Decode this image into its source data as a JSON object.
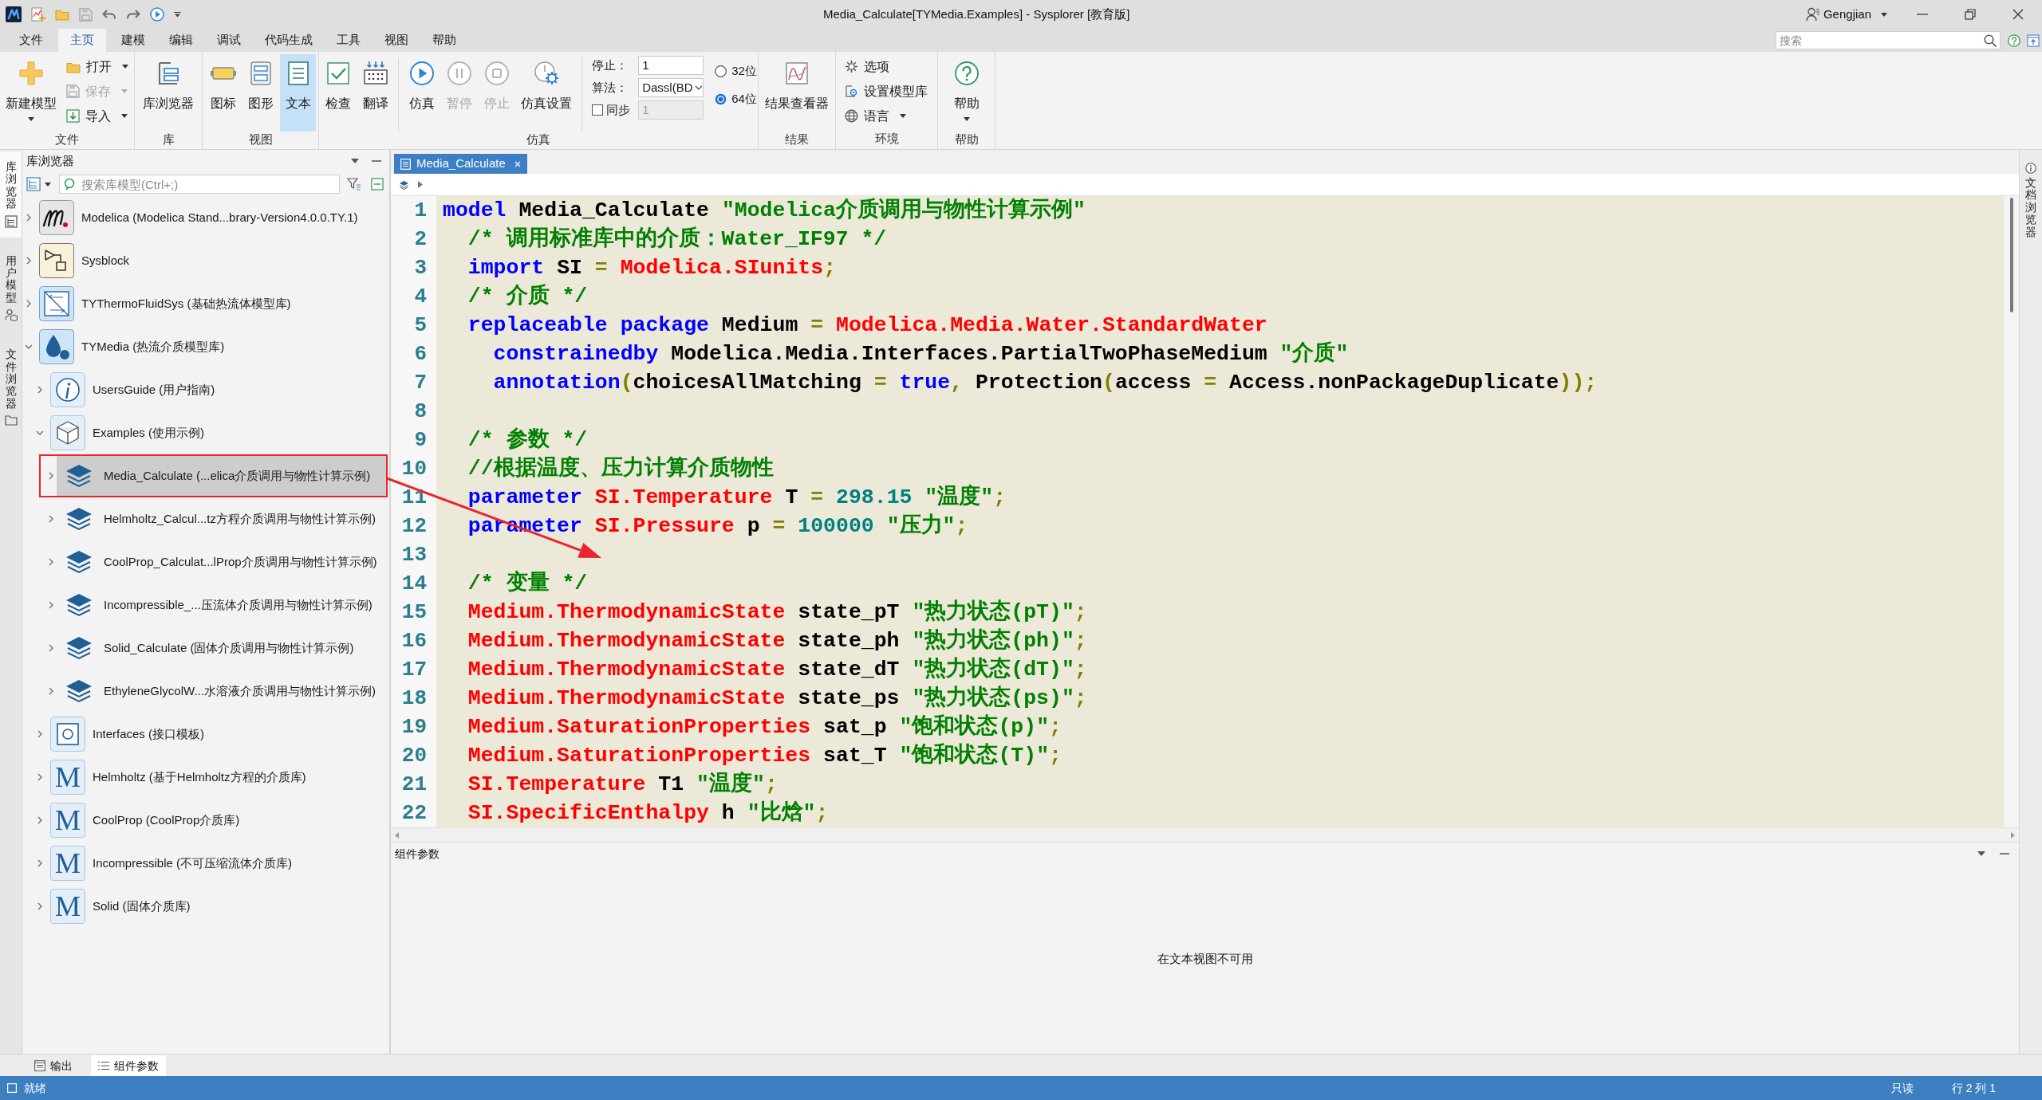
{
  "window": {
    "title": "Media_Calculate[TYMedia.Examples] - Sysplorer [教育版]",
    "user": "Gengjian"
  },
  "menu_bar": {
    "tabs": [
      {
        "label": "文件",
        "selected": false
      },
      {
        "label": "主页",
        "selected": true
      },
      {
        "label": "建模",
        "selected": false
      },
      {
        "label": "编辑",
        "selected": false
      },
      {
        "label": "调试",
        "selected": false
      },
      {
        "label": "代码生成",
        "selected": false
      },
      {
        "label": "工具",
        "selected": false
      },
      {
        "label": "视图",
        "selected": false
      },
      {
        "label": "帮助",
        "selected": false
      }
    ],
    "search": {
      "placeholder": "搜索"
    }
  },
  "ribbon": [
    {
      "label": "文件",
      "items": [
        {
          "kind": "large",
          "label": "新建模型",
          "dropdown": true,
          "disabled": false
        },
        {
          "kind": "stack",
          "buttons": [
            {
              "label": "打开",
              "dropdown": true,
              "disabled": false
            },
            {
              "label": "保存",
              "dropdown": true,
              "disabled": true
            },
            {
              "label": "导入",
              "dropdown": true,
              "disabled": false
            }
          ]
        }
      ]
    },
    {
      "label": "库",
      "items": [
        {
          "kind": "large",
          "label": "库浏览器",
          "dropdown": false,
          "disabled": false
        }
      ]
    },
    {
      "label": "视图",
      "items": [
        {
          "kind": "large",
          "label": "图标",
          "dropdown": false,
          "disabled": false,
          "selected": false
        },
        {
          "kind": "large",
          "label": "图形",
          "dropdown": false,
          "disabled": false,
          "selected": false
        },
        {
          "kind": "large",
          "label": "文本",
          "dropdown": false,
          "disabled": false,
          "selected": true
        }
      ]
    },
    {
      "label": "仿真",
      "items": [
        {
          "kind": "large",
          "label": "检查",
          "dropdown": false,
          "disabled": false
        },
        {
          "kind": "large",
          "label": "翻译",
          "dropdown": false,
          "disabled": false
        },
        {
          "kind": "separator"
        },
        {
          "kind": "large",
          "label": "仿真",
          "dropdown": false,
          "disabled": false
        },
        {
          "kind": "large",
          "label": "暂停",
          "dropdown": false,
          "disabled": true
        },
        {
          "kind": "large",
          "label": "停止",
          "dropdown": false,
          "disabled": true
        },
        {
          "kind": "large",
          "label": "仿真设置",
          "dropdown": false,
          "disabled": false
        },
        {
          "kind": "separator"
        },
        {
          "kind": "form",
          "fields": [
            {
              "kind": "input",
              "label": "停止：",
              "value": "1",
              "disabled": false
            },
            {
              "kind": "select",
              "label": "算法：",
              "value": "Dassl(BD"
            },
            {
              "kind": "checkbox",
              "label": "同步",
              "checked": false,
              "value": "1",
              "disabled": true
            }
          ]
        },
        {
          "kind": "radios",
          "options": [
            {
              "label": "32位",
              "selected": false
            },
            {
              "label": "64位",
              "selected": true
            }
          ]
        }
      ]
    },
    {
      "label": "结果",
      "items": [
        {
          "kind": "large",
          "label": "结果查看器",
          "dropdown": false,
          "disabled": false
        }
      ]
    },
    {
      "label": "环境",
      "items": [
        {
          "kind": "stack",
          "buttons": [
            {
              "label": "选项",
              "dropdown": false,
              "disabled": false
            },
            {
              "label": "设置模型库",
              "dropdown": false,
              "disabled": false
            },
            {
              "label": "语言",
              "dropdown": true,
              "disabled": false
            }
          ]
        }
      ]
    },
    {
      "label": "帮助",
      "items": [
        {
          "kind": "large",
          "label": "帮助",
          "dropdown": true,
          "disabled": false
        }
      ]
    }
  ],
  "side_tabs": [
    {
      "label": "库浏览器",
      "selected": true
    },
    {
      "label": "用户模型",
      "selected": false
    },
    {
      "label": "文件浏览器",
      "selected": false
    }
  ],
  "library_browser": {
    "title": "库浏览器",
    "search": {
      "placeholder": "搜索库模型(Ctrl+;)"
    },
    "tree": [
      {
        "label": "Modelica (Modelica Stand...brary-Version4.0.0.TY.1)",
        "kind": "modelica",
        "expanded": false,
        "selected": false,
        "annotated": false
      },
      {
        "label": "Sysblock",
        "kind": "sysblock",
        "expanded": false,
        "selected": false,
        "annotated": false
      },
      {
        "label": "TYThermoFluidSys (基础热流体模型库)",
        "kind": "fluidsys",
        "expanded": false,
        "selected": false,
        "annotated": false
      },
      {
        "label": "TYMedia (热流介质模型库)",
        "kind": "media",
        "expanded": true,
        "selected": false,
        "annotated": false,
        "children": [
          {
            "label": "UsersGuide (用户指南)",
            "kind": "guide",
            "expanded": false,
            "selected": false,
            "annotated": false
          },
          {
            "label": "Examples (使用示例)",
            "kind": "examples",
            "expanded": true,
            "selected": false,
            "annotated": false,
            "children": [
              {
                "label": "Media_Calculate (...elica介质调用与物性计算示例)",
                "kind": "example",
                "expanded": false,
                "selected": true,
                "annotated": true
              },
              {
                "label": "Helmholtz_Calcul...tz方程介质调用与物性计算示例)",
                "kind": "example",
                "expanded": false,
                "selected": false,
                "annotated": false
              },
              {
                "label": "CoolProp_Calculat...lProp介质调用与物性计算示例)",
                "kind": "example",
                "expanded": false,
                "selected": false,
                "annotated": false
              },
              {
                "label": "Incompressible_...压流体介质调用与物性计算示例)",
                "kind": "example",
                "expanded": false,
                "selected": false,
                "annotated": false
              },
              {
                "label": "Solid_Calculate (固体介质调用与物性计算示例)",
                "kind": "example",
                "expanded": false,
                "selected": false,
                "annotated": false
              },
              {
                "label": "EthyleneGlycolW...水溶液介质调用与物性计算示例)",
                "kind": "example",
                "expanded": false,
                "selected": false,
                "annotated": false
              }
            ]
          },
          {
            "label": "Interfaces (接口模板)",
            "kind": "interfaces",
            "expanded": false,
            "selected": false,
            "annotated": false
          },
          {
            "label": "Helmholtz (基于Helmholtz方程的介质库)",
            "kind": "package",
            "badge": "M",
            "expanded": false,
            "selected": false,
            "annotated": false
          },
          {
            "label": "CoolProp (CoolProp介质库)",
            "kind": "package",
            "badge": "M",
            "expanded": false,
            "selected": false,
            "annotated": false
          },
          {
            "label": "Incompressible (不可压缩流体介质库)",
            "kind": "package",
            "badge": "M",
            "expanded": false,
            "selected": false,
            "annotated": false
          },
          {
            "label": "Solid (固体介质库)",
            "kind": "package",
            "badge": "M",
            "expanded": false,
            "selected": false,
            "annotated": false
          }
        ]
      }
    ]
  },
  "editor": {
    "tabs": [
      {
        "label": "Media_Calculate",
        "selected": true
      }
    ],
    "lines": [
      {
        "number": "1",
        "tokens": [
          {
            "kind": "keyword",
            "text": "model"
          },
          {
            "kind": "plain",
            "text": " Media_Calculate "
          },
          {
            "kind": "string",
            "text": "\"Modelica介质调用与物性计算示例\""
          }
        ]
      },
      {
        "number": "2",
        "tokens": [
          {
            "kind": "comment",
            "text": "  /* 调用标准库中的介质：Water_IF97 */"
          }
        ]
      },
      {
        "number": "3",
        "tokens": [
          {
            "kind": "keyword",
            "text": "  import"
          },
          {
            "kind": "plain",
            "text": " SI "
          },
          {
            "kind": "operator",
            "text": "= "
          },
          {
            "kind": "type",
            "text": "Modelica.SIunits"
          },
          {
            "kind": "operator",
            "text": ";"
          }
        ]
      },
      {
        "number": "4",
        "tokens": [
          {
            "kind": "comment",
            "text": "  /* 介质 */"
          }
        ]
      },
      {
        "number": "5",
        "tokens": [
          {
            "kind": "keyword",
            "text": "  replaceable package"
          },
          {
            "kind": "plain",
            "text": " Medium "
          },
          {
            "kind": "operator",
            "text": "= "
          },
          {
            "kind": "type",
            "text": "Modelica.Media.Water.StandardWater"
          }
        ]
      },
      {
        "number": "6",
        "tokens": [
          {
            "kind": "keyword",
            "text": "    constrainedby"
          },
          {
            "kind": "plain",
            "text": " Modelica.Media.Interfaces.PartialTwoPhaseMedium "
          },
          {
            "kind": "string",
            "text": "\"介质\""
          }
        ]
      },
      {
        "number": "7",
        "tokens": [
          {
            "kind": "keyword",
            "text": "    annotation"
          },
          {
            "kind": "operator",
            "text": "("
          },
          {
            "kind": "plain",
            "text": "choicesAllMatching "
          },
          {
            "kind": "operator",
            "text": "= "
          },
          {
            "kind": "keyword",
            "text": "true"
          },
          {
            "kind": "operator",
            "text": ", "
          },
          {
            "kind": "plain",
            "text": "Protection"
          },
          {
            "kind": "operator",
            "text": "("
          },
          {
            "kind": "plain",
            "text": "access "
          },
          {
            "kind": "operator",
            "text": "= "
          },
          {
            "kind": "plain",
            "text": "Access.nonPackageDuplicate"
          },
          {
            "kind": "operator",
            "text": "));"
          }
        ]
      },
      {
        "number": "8"
      },
      {
        "number": "9",
        "tokens": [
          {
            "kind": "comment",
            "text": "  /* 参数 */"
          }
        ]
      },
      {
        "number": "10",
        "tokens": [
          {
            "kind": "comment",
            "text": "  //根据温度、压力计算介质物性"
          }
        ]
      },
      {
        "number": "11",
        "tokens": [
          {
            "kind": "keyword",
            "text": "  parameter "
          },
          {
            "kind": "type",
            "text": "SI.Temperature"
          },
          {
            "kind": "plain",
            "text": " T "
          },
          {
            "kind": "operator",
            "text": "= "
          },
          {
            "kind": "number",
            "text": "298.15 "
          },
          {
            "kind": "string",
            "text": "\"温度\""
          },
          {
            "kind": "operator",
            "text": ";"
          }
        ]
      },
      {
        "number": "12",
        "tokens": [
          {
            "kind": "keyword",
            "text": "  parameter "
          },
          {
            "kind": "type",
            "text": "SI.Pressure"
          },
          {
            "kind": "plain",
            "text": " p "
          },
          {
            "kind": "operator",
            "text": "= "
          },
          {
            "kind": "number",
            "text": "100000 "
          },
          {
            "kind": "string",
            "text": "\"压力\""
          },
          {
            "kind": "operator",
            "text": ";"
          }
        ]
      },
      {
        "number": "13"
      },
      {
        "number": "14",
        "tokens": [
          {
            "kind": "comment",
            "text": "  /* 变量 */"
          }
        ]
      },
      {
        "number": "15",
        "tokens": [
          {
            "kind": "type",
            "text": "  Medium.ThermodynamicState"
          },
          {
            "kind": "plain",
            "text": " state_pT "
          },
          {
            "kind": "string",
            "text": "\"热力状态(pT)\""
          },
          {
            "kind": "operator",
            "text": ";"
          }
        ]
      },
      {
        "number": "16",
        "tokens": [
          {
            "kind": "type",
            "text": "  Medium.ThermodynamicState"
          },
          {
            "kind": "plain",
            "text": " state_ph "
          },
          {
            "kind": "string",
            "text": "\"热力状态(ph)\""
          },
          {
            "kind": "operator",
            "text": ";"
          }
        ]
      },
      {
        "number": "17",
        "tokens": [
          {
            "kind": "type",
            "text": "  Medium.ThermodynamicState"
          },
          {
            "kind": "plain",
            "text": " state_dT "
          },
          {
            "kind": "string",
            "text": "\"热力状态(dT)\""
          },
          {
            "kind": "operator",
            "text": ";"
          }
        ]
      },
      {
        "number": "18",
        "tokens": [
          {
            "kind": "type",
            "text": "  Medium.ThermodynamicState"
          },
          {
            "kind": "plain",
            "text": " state_ps "
          },
          {
            "kind": "string",
            "text": "\"热力状态(ps)\""
          },
          {
            "kind": "operator",
            "text": ";"
          }
        ]
      },
      {
        "number": "19",
        "tokens": [
          {
            "kind": "type",
            "text": "  Medium.SaturationProperties"
          },
          {
            "kind": "plain",
            "text": " sat_p "
          },
          {
            "kind": "string",
            "text": "\"饱和状态(p)\""
          },
          {
            "kind": "operator",
            "text": ";"
          }
        ]
      },
      {
        "number": "20",
        "tokens": [
          {
            "kind": "type",
            "text": "  Medium.SaturationProperties"
          },
          {
            "kind": "plain",
            "text": " sat_T "
          },
          {
            "kind": "string",
            "text": "\"饱和状态(T)\""
          },
          {
            "kind": "operator",
            "text": ";"
          }
        ]
      },
      {
        "number": "21",
        "tokens": [
          {
            "kind": "type",
            "text": "  SI.Temperature"
          },
          {
            "kind": "plain",
            "text": " T1 "
          },
          {
            "kind": "string",
            "text": "\"温度\""
          },
          {
            "kind": "operator",
            "text": ";"
          }
        ]
      },
      {
        "number": "22",
        "tokens": [
          {
            "kind": "type",
            "text": "  SI.SpecificEnthalpy"
          },
          {
            "kind": "plain",
            "text": " h "
          },
          {
            "kind": "string",
            "text": "\"比焓\""
          },
          {
            "kind": "operator",
            "text": ";"
          }
        ]
      }
    ]
  },
  "parameters_panel": {
    "title": "组件参数",
    "message": "在文本视图不可用"
  },
  "right_tabs": [
    {
      "label": "文档浏览器"
    }
  ],
  "bottom_tabs": [
    {
      "label": "输出",
      "selected": false
    },
    {
      "label": "组件参数",
      "selected": true
    }
  ],
  "status_bar": {
    "status": "就绪",
    "mode": "只读",
    "position": "行 2 列 1"
  }
}
